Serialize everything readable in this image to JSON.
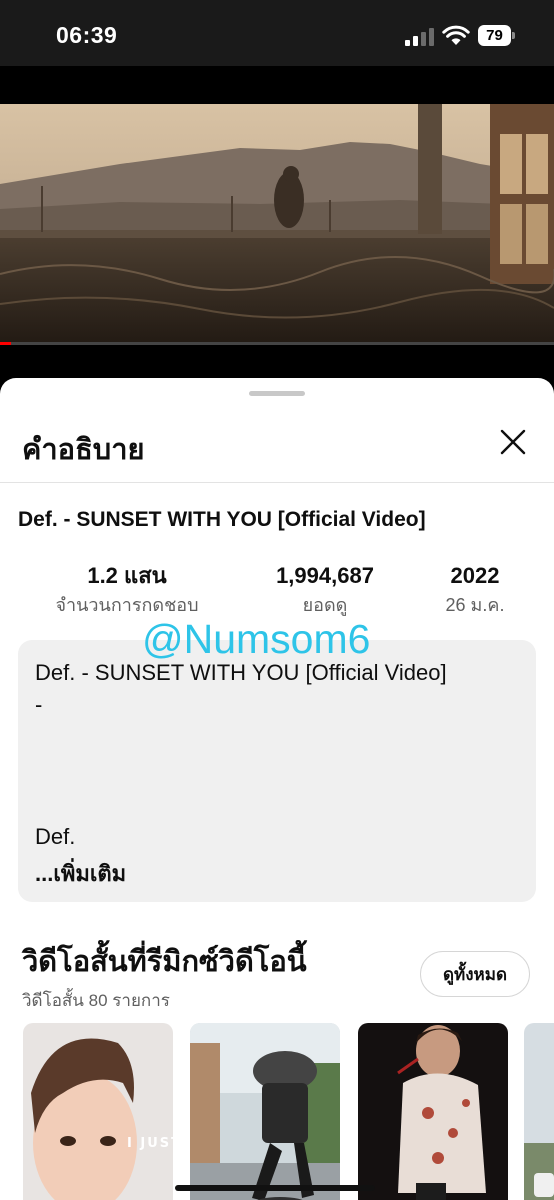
{
  "status_bar": {
    "time": "06:39",
    "battery": "79"
  },
  "video": {
    "progress": 0.02,
    "accent_color": "#ff0000"
  },
  "sheet": {
    "title": "คำอธิบาย",
    "close_icon": "close-icon"
  },
  "video_info": {
    "title": "Def. - SUNSET WITH YOU [Official Video]",
    "stats": [
      {
        "value": "1.2 แสน",
        "label": "จำนวนการกดชอบ"
      },
      {
        "value": "1,994,687",
        "label": "ยอดดู"
      },
      {
        "value": "2022",
        "label": "26 ม.ค."
      }
    ]
  },
  "watermark": "@Numsom6",
  "description": {
    "lines": [
      "Def. - SUNSET WITH YOU [Official Video]",
      "-",
      "Def."
    ],
    "more_label": "...เพิ่มเติม"
  },
  "shorts": {
    "title": "วิดีโอสั้นที่รีมิกซ์วิดีโอนี้",
    "subtitle": "วิดีโอสั้น 80 รายการ",
    "view_all_label": "ดูทั้งหมด",
    "thumb_caption": "I JUST S"
  }
}
